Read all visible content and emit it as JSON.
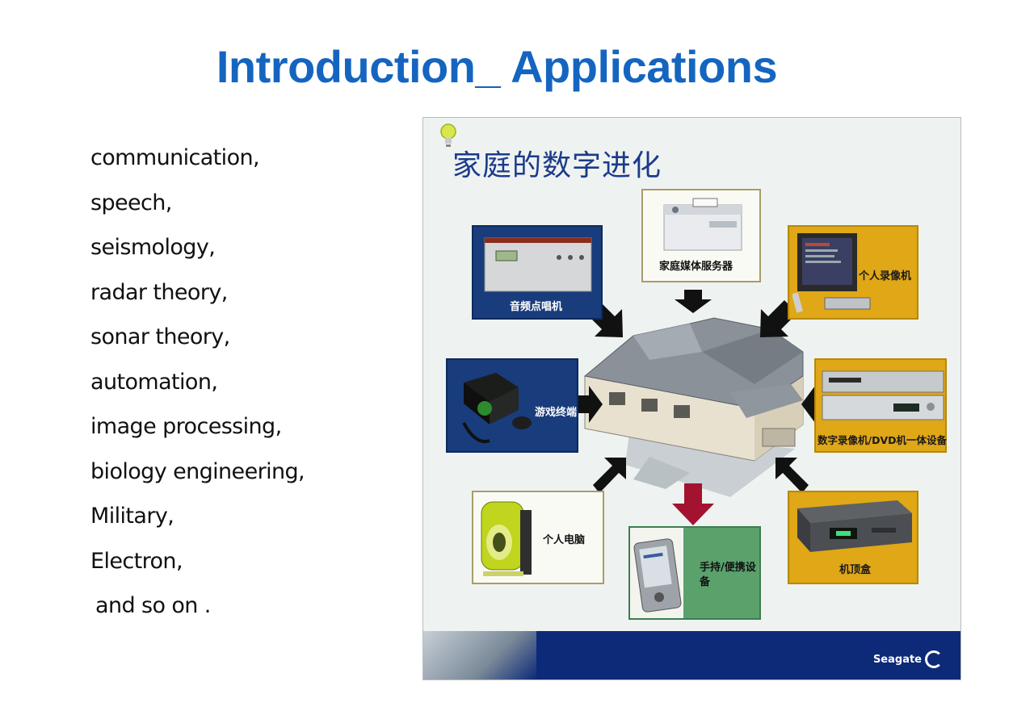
{
  "slide": {
    "title": "Introduction_ Applications"
  },
  "applications": [
    "communication,",
    "speech,",
    "seismology,",
    "radar theory,",
    "sonar theory,",
    "automation,",
    "image processing,",
    "biology engineering,",
    "Military,",
    "Electron,",
    " and so on ."
  ],
  "image": {
    "heading": "家庭的数字进化",
    "cards": {
      "media_server": "家庭媒体服务器",
      "audio_jukebox": "音频点唱机",
      "personal_recorder": "个人录像机",
      "game_console": "游戏终端",
      "dvr_dvd": "数字录像机/DVD机一体设备",
      "personal_computer": "个人电脑",
      "handheld_line1": "手持/便携设",
      "handheld_line2": "备",
      "set_top_box": "机顶盒"
    },
    "brand": "Seagate",
    "colors": {
      "navy": "#193c7c",
      "gold": "#e0a716",
      "green": "#5aa16c",
      "arrow_red": "#a3122e"
    }
  }
}
